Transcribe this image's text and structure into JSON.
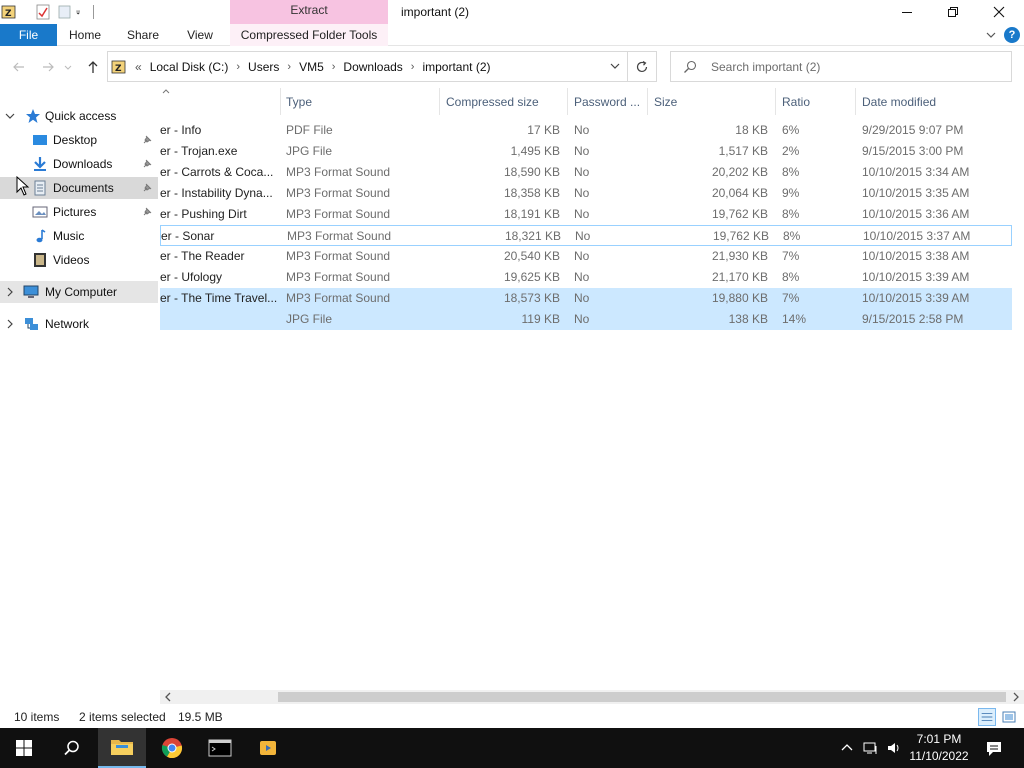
{
  "window": {
    "title": "important (2)",
    "context_tab_group": "Extract",
    "minimize_icon": "minimize-icon",
    "maximize_icon": "maximize-icon",
    "close_icon": "close-icon"
  },
  "ribbon": {
    "tabs": [
      "File",
      "Home",
      "Share",
      "View"
    ],
    "context_tab": "Compressed Folder Tools",
    "help_label": "?"
  },
  "address": {
    "overflow": "«",
    "crumbs": [
      "Local Disk (C:)",
      "Users",
      "VM5",
      "Downloads",
      "important (2)"
    ]
  },
  "search": {
    "placeholder": "Search important (2)"
  },
  "nav": {
    "quick_access": "Quick access",
    "items": [
      {
        "label": "Desktop",
        "icon": "desktop-icon",
        "pinned": true
      },
      {
        "label": "Downloads",
        "icon": "downloads-icon",
        "pinned": true
      },
      {
        "label": "Documents",
        "icon": "documents-icon",
        "pinned": true
      },
      {
        "label": "Pictures",
        "icon": "pictures-icon",
        "pinned": true
      },
      {
        "label": "Music",
        "icon": "music-icon",
        "pinned": false
      },
      {
        "label": "Videos",
        "icon": "videos-icon",
        "pinned": false
      }
    ],
    "my_computer": "My Computer",
    "network": "Network"
  },
  "columns": [
    "Type",
    "Compressed size",
    "Password ...",
    "Size",
    "Ratio",
    "Date modified"
  ],
  "files": [
    {
      "name": "er - Info",
      "type": "PDF File",
      "compressed": "17 KB",
      "password": "No",
      "size": "18 KB",
      "ratio": "6%",
      "date": "9/29/2015 9:07 PM",
      "state": ""
    },
    {
      "name": "er - Trojan.exe",
      "type": "JPG File",
      "compressed": "1,495 KB",
      "password": "No",
      "size": "1,517 KB",
      "ratio": "2%",
      "date": "9/15/2015 3:00 PM",
      "state": ""
    },
    {
      "name": "er - Carrots & Coca...",
      "type": "MP3 Format Sound",
      "compressed": "18,590 KB",
      "password": "No",
      "size": "20,202 KB",
      "ratio": "8%",
      "date": "10/10/2015 3:34 AM",
      "state": ""
    },
    {
      "name": "er - Instability Dyna...",
      "type": "MP3 Format Sound",
      "compressed": "18,358 KB",
      "password": "No",
      "size": "20,064 KB",
      "ratio": "9%",
      "date": "10/10/2015 3:35 AM",
      "state": ""
    },
    {
      "name": "er - Pushing Dirt",
      "type": "MP3 Format Sound",
      "compressed": "18,191 KB",
      "password": "No",
      "size": "19,762 KB",
      "ratio": "8%",
      "date": "10/10/2015 3:36 AM",
      "state": ""
    },
    {
      "name": "er - Sonar",
      "type": "MP3 Format Sound",
      "compressed": "18,321 KB",
      "password": "No",
      "size": "19,762 KB",
      "ratio": "8%",
      "date": "10/10/2015 3:37 AM",
      "state": "focus"
    },
    {
      "name": "er - The Reader",
      "type": "MP3 Format Sound",
      "compressed": "20,540 KB",
      "password": "No",
      "size": "21,930 KB",
      "ratio": "7%",
      "date": "10/10/2015 3:38 AM",
      "state": ""
    },
    {
      "name": "er - Ufology",
      "type": "MP3 Format Sound",
      "compressed": "19,625 KB",
      "password": "No",
      "size": "21,170 KB",
      "ratio": "8%",
      "date": "10/10/2015 3:39 AM",
      "state": ""
    },
    {
      "name": "er - The Time Travel...",
      "type": "MP3 Format Sound",
      "compressed": "18,573 KB",
      "password": "No",
      "size": "19,880 KB",
      "ratio": "7%",
      "date": "10/10/2015 3:39 AM",
      "state": "selected"
    },
    {
      "name": "",
      "type": "JPG File",
      "compressed": "119 KB",
      "password": "No",
      "size": "138 KB",
      "ratio": "14%",
      "date": "9/15/2015 2:58 PM",
      "state": "selected"
    }
  ],
  "status": {
    "count": "10 items",
    "selection": "2 items selected",
    "selection_size": "19.5 MB"
  },
  "taskbar": {
    "apps": [
      "start-icon",
      "search-icon",
      "file-explorer-icon",
      "chrome-icon",
      "terminal-icon",
      "media-app-icon"
    ],
    "time": "7:01 PM",
    "date": "11/10/2022"
  },
  "colors": {
    "file_tab": "#1979ca",
    "context_tab": "#f7c3e1",
    "selection": "#cce8ff",
    "taskbar": "#101010"
  }
}
